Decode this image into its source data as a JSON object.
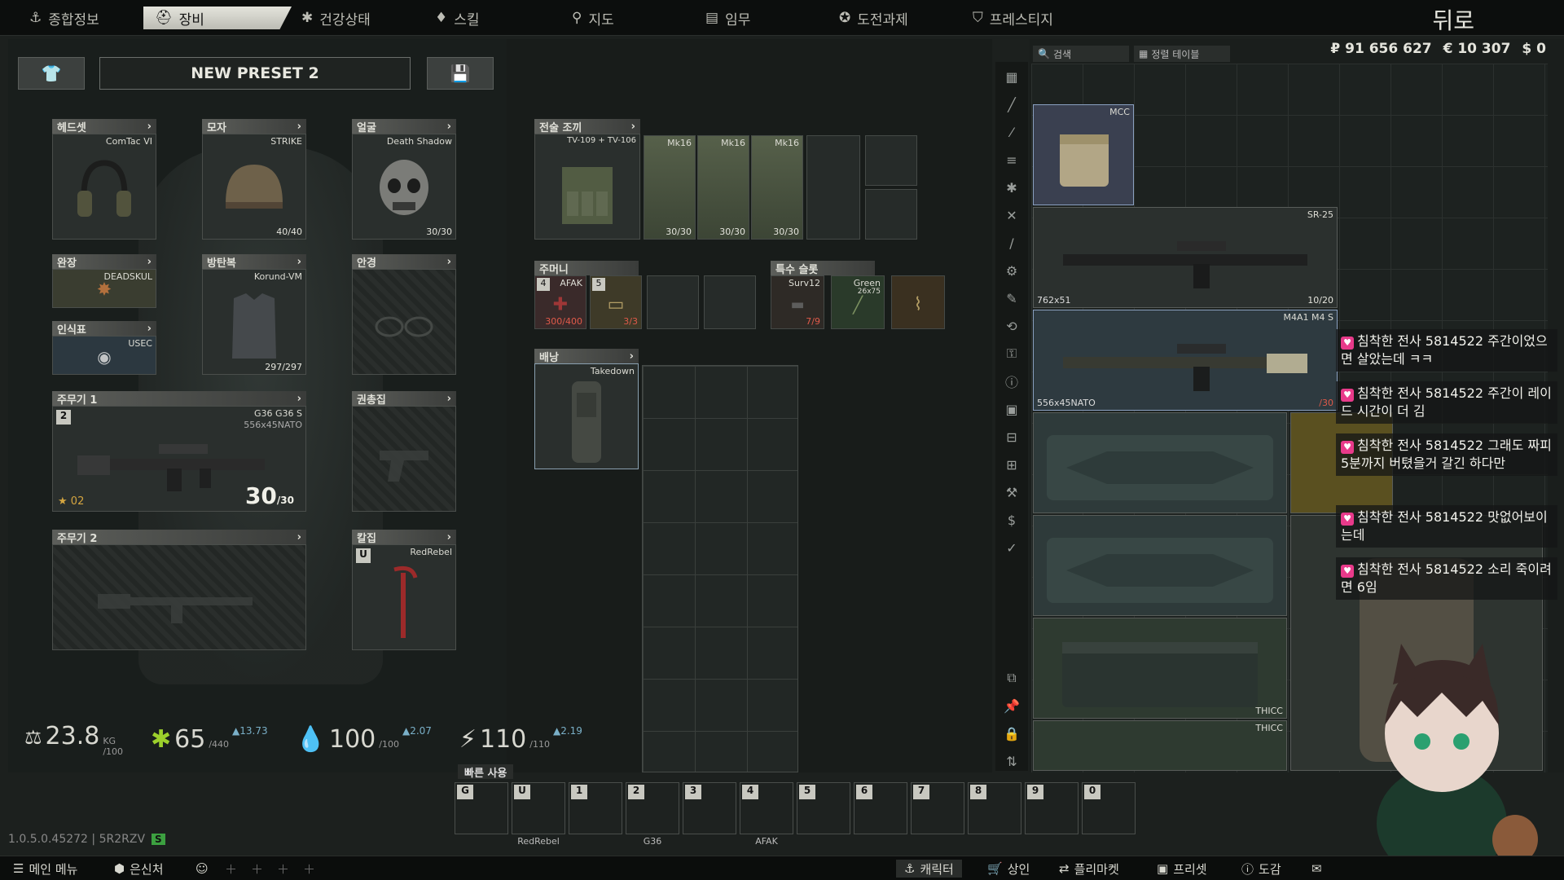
{
  "tabs": [
    {
      "label": "종합정보",
      "icon": "anchor-icon"
    },
    {
      "label": "장비",
      "icon": "gear-icon"
    },
    {
      "label": "건강상태",
      "icon": "asterisk-icon"
    },
    {
      "label": "스킬",
      "icon": "skill-icon"
    },
    {
      "label": "지도",
      "icon": "pin-icon"
    },
    {
      "label": "임무",
      "icon": "task-icon"
    },
    {
      "label": "도전과제",
      "icon": "star-icon"
    },
    {
      "label": "프레스티지",
      "icon": "shield-icon"
    }
  ],
  "back_label": "뒤로",
  "preset": {
    "name": "NEW PRESET 2"
  },
  "slots": {
    "headset": {
      "label": "헤드셋",
      "item": "ComTac VI"
    },
    "hat": {
      "label": "모자",
      "item": "STRIKE",
      "count": "40/40"
    },
    "face": {
      "label": "얼굴",
      "item": "Death Shadow",
      "count": "30/30"
    },
    "armband": {
      "label": "완장",
      "item": "DEADSKUL"
    },
    "armor": {
      "label": "방탄복",
      "item": "Korund-VM",
      "count": "297/297"
    },
    "eyewear": {
      "label": "안경"
    },
    "dogtag": {
      "label": "인식표",
      "item": "USEC"
    },
    "primary1": {
      "label": "주무기 1",
      "item": "G36 G36 S",
      "caliber": "556x45NATO",
      "ammo": "30",
      "ammo_max": "/30",
      "slot_num": "2",
      "rank": "02"
    },
    "holster": {
      "label": "권총집"
    },
    "primary2": {
      "label": "주무기 2"
    },
    "scabbard": {
      "label": "칼집",
      "item": "RedRebel",
      "key": "U"
    },
    "rig": {
      "label": "전술 조끼",
      "item": "TV-109 + TV-106"
    },
    "pockets": {
      "label": "주머니"
    },
    "special": {
      "label": "특수 슬롯"
    },
    "backpack": {
      "label": "배낭",
      "item": "Takedown"
    }
  },
  "rig_cells": [
    {
      "name": "Mk16",
      "count": "30/30"
    },
    {
      "name": "Mk16",
      "count": "30/30"
    },
    {
      "name": "Mk16",
      "count": "30/30"
    }
  ],
  "pocket_cells": [
    {
      "num": "4",
      "name": "AFAK",
      "count": "300/400"
    },
    {
      "num": "5",
      "name": "",
      "count": "3/3"
    }
  ],
  "special_cells": [
    {
      "name": "Surv12",
      "count": "7/9"
    },
    {
      "name": "Green",
      "sub": "26x75"
    },
    {
      "name": ""
    }
  ],
  "stats": {
    "weight": "23.8",
    "weight_max": "/100",
    "weight_unit": "KG",
    "energy": "65",
    "energy_max": "/440",
    "energy_up": "13.73",
    "hydration": "100",
    "hydration_max": "/100",
    "hydration_up": "2.07",
    "energy2": "110",
    "energy2_max": "/110",
    "energy2_up": "2.19"
  },
  "quickbar": {
    "label": "빠른 사용",
    "keys": [
      "G",
      "U",
      "1",
      "2",
      "3",
      "4",
      "5",
      "6",
      "7",
      "8",
      "9",
      "0"
    ],
    "labels": [
      "",
      "RedRebel",
      "",
      "G36",
      "",
      "AFAK",
      "",
      "",
      "",
      "",
      "",
      ""
    ]
  },
  "stash": {
    "search_placeholder": "검색",
    "sort_label": "정렬 테이블",
    "money_rub": "₽ 91 656 627",
    "money_eur": "€ 10 307",
    "money_usd": "$ 0",
    "items": [
      {
        "name": "MCC"
      },
      {
        "name": "SR-25",
        "caliber": "762x51",
        "count": "10/20"
      },
      {
        "name": "M4A1 M4 S",
        "caliber": "556x45NATO",
        "count": "/30"
      },
      {
        "name": "THICC"
      },
      {
        "name": "THICC"
      }
    ]
  },
  "chat": [
    {
      "user": "침착한 전사 5814522",
      "msg": "주간이었으면 살았는데 ㅋㅋ"
    },
    {
      "user": "침착한 전사 5814522",
      "msg": "주간이 레이드 시간이 더 김"
    },
    {
      "user": "침착한 전사 5814522",
      "msg": "그래도 짜피 5분까지 버텼을거 갈긴 하다만"
    },
    {
      "user": "침착한 전사 5814522",
      "msg": "맛없어보이는데"
    },
    {
      "user": "침착한 전사 5814522",
      "msg": "소리 죽이려면 6임"
    }
  ],
  "version": {
    "text": "1.0.5.0.45272 | 5R2RZV",
    "badge": "S"
  },
  "bottom_left": [
    {
      "label": "메인 메뉴",
      "icon": "menu-icon"
    },
    {
      "label": "은신처",
      "icon": "hideout-icon"
    }
  ],
  "bottom_right": [
    {
      "label": "캐릭터",
      "icon": "character-icon"
    },
    {
      "label": "상인",
      "icon": "cart-icon"
    },
    {
      "label": "플리마켓",
      "icon": "swap-icon"
    },
    {
      "label": "프리셋",
      "icon": "preset-icon"
    },
    {
      "label": "도감",
      "icon": "book-icon"
    }
  ]
}
